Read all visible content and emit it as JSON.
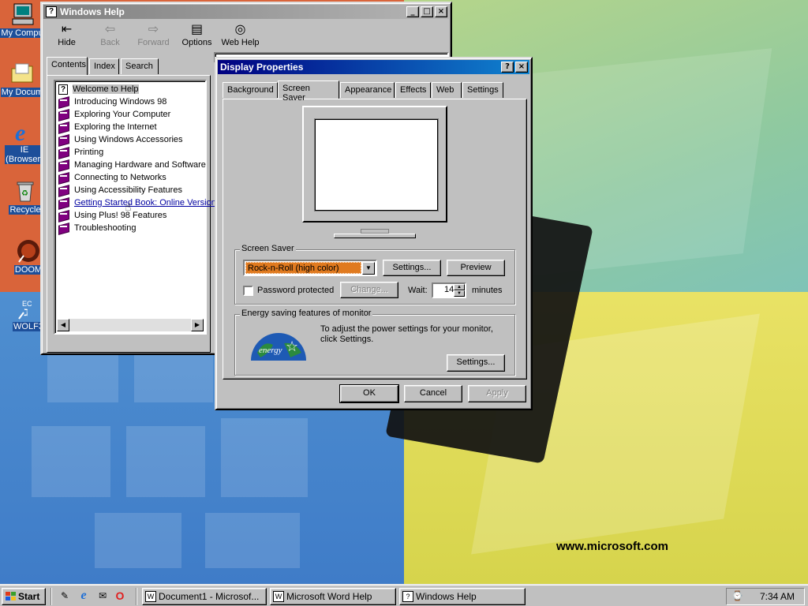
{
  "desktop": {
    "icons": [
      {
        "label": "My Compu"
      },
      {
        "label": "My Docum"
      },
      {
        "label": "IE (Browser)"
      },
      {
        "label": "Recycle"
      },
      {
        "label": "DOOM"
      },
      {
        "label": "WOLF3"
      }
    ],
    "wallpaper_url": "www.microsoft.com"
  },
  "help_window": {
    "title": "Windows Help",
    "toolbar": [
      {
        "label": "Hide",
        "icon": "hide-icon",
        "enabled": true
      },
      {
        "label": "Back",
        "icon": "back-arrow-icon",
        "enabled": false
      },
      {
        "label": "Forward",
        "icon": "forward-arrow-icon",
        "enabled": false
      },
      {
        "label": "Options",
        "icon": "options-icon",
        "enabled": true
      },
      {
        "label": "Web Help",
        "icon": "web-help-icon",
        "enabled": true
      }
    ],
    "tabs": [
      "Contents",
      "Index",
      "Search"
    ],
    "active_tab": "Contents",
    "tree": [
      {
        "label": "Welcome to Help",
        "icon": "question-page-icon"
      },
      {
        "label": "Introducing Windows 98",
        "icon": "book-icon"
      },
      {
        "label": "Exploring Your Computer",
        "icon": "book-icon"
      },
      {
        "label": "Exploring the Internet",
        "icon": "book-icon"
      },
      {
        "label": "Using Windows Accessories",
        "icon": "book-icon"
      },
      {
        "label": "Printing",
        "icon": "book-icon"
      },
      {
        "label": "Managing Hardware and Software",
        "icon": "book-icon"
      },
      {
        "label": "Connecting to Networks",
        "icon": "book-icon"
      },
      {
        "label": "Using Accessibility Features",
        "icon": "book-icon"
      },
      {
        "label": "Getting Started Book: Online Version",
        "icon": "book-icon"
      },
      {
        "label": "Using Plus! 98 Features",
        "icon": "book-icon"
      },
      {
        "label": "Troubleshooting",
        "icon": "book-icon"
      }
    ]
  },
  "display_properties": {
    "title": "Display Properties",
    "tabs": [
      "Background",
      "Screen Saver",
      "Appearance",
      "Effects",
      "Web",
      "Settings"
    ],
    "active_tab": "Screen Saver",
    "screen_saver": {
      "group_label": "Screen Saver",
      "selected": "Rock-n-Roll (high color)",
      "settings_button": "Settings...",
      "preview_button": "Preview",
      "password_label": "Password protected",
      "password_checked": false,
      "change_button": "Change...",
      "wait_label": "Wait:",
      "wait_value": "14",
      "minutes_label": "minutes"
    },
    "energy": {
      "group_label": "Energy saving features of monitor",
      "description": "To adjust the power settings for your monitor, click Settings.",
      "settings_button": "Settings...",
      "logo_text": "energy"
    },
    "buttons": {
      "ok": "OK",
      "cancel": "Cancel",
      "apply": "Apply"
    }
  },
  "taskbar": {
    "start_label": "Start",
    "tasks": [
      {
        "label": "Document1 - Microsof..."
      },
      {
        "label": "Microsoft Word Help"
      },
      {
        "label": "Windows Help"
      }
    ],
    "clock": "7:34 AM"
  },
  "colors": {
    "title_active": "#000080",
    "title_inactive": "#808080",
    "selection_orange": "#e07a1f",
    "desktop_teal": "#3a6ea5"
  }
}
